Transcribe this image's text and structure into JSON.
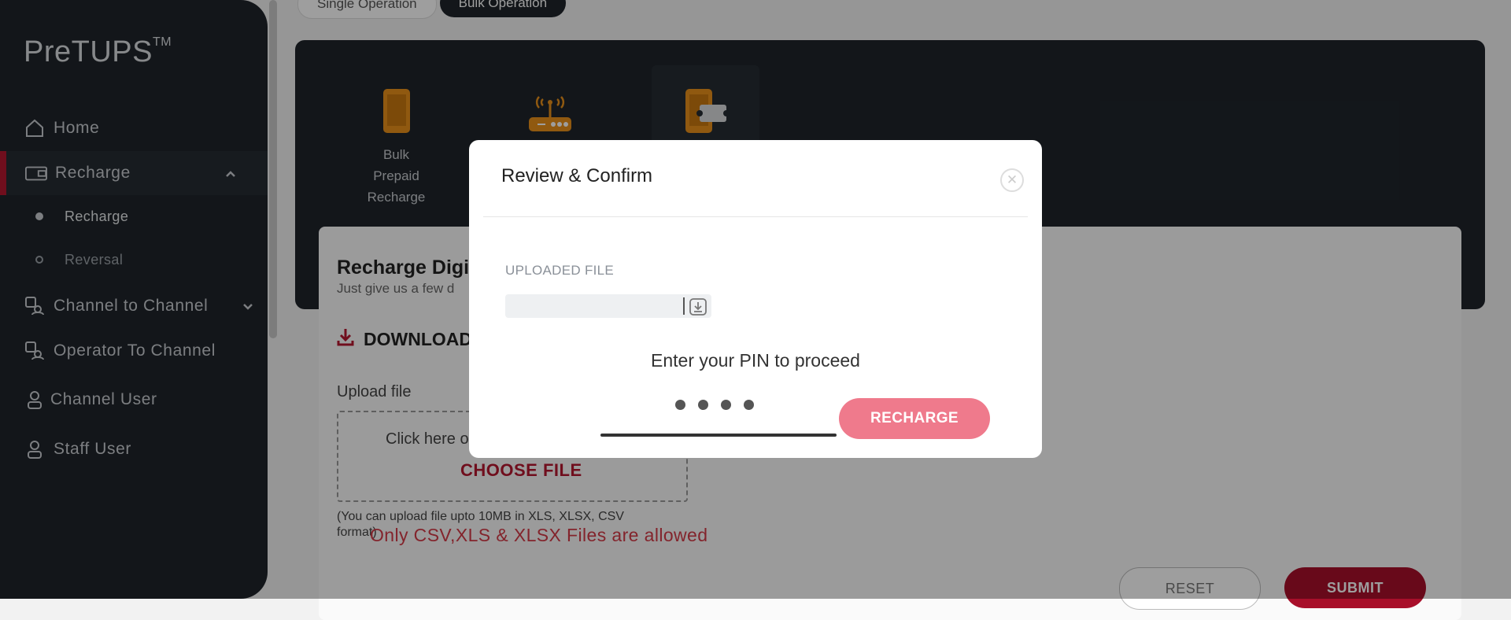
{
  "app": {
    "logo": "PreTUPS",
    "logo_tm": "TM"
  },
  "sidebar": {
    "items": [
      {
        "label": "Home",
        "icon": "home-icon"
      },
      {
        "label": "Recharge",
        "icon": "wallet-icon",
        "active": true,
        "expanded": true
      },
      {
        "label": "Channel to Channel",
        "icon": "transfer-icon"
      },
      {
        "label": "Operator To Channel",
        "icon": "transfer-icon"
      },
      {
        "label": "Channel User",
        "icon": "user-icon"
      },
      {
        "label": "Staff User",
        "icon": "user-icon"
      }
    ],
    "sub_items": [
      {
        "label": "Recharge",
        "active": true
      },
      {
        "label": "Reversal",
        "active": false
      }
    ]
  },
  "toggles": {
    "single": "Single Operation",
    "bulk": "Bulk Operation"
  },
  "tiles": [
    {
      "lines": [
        "Bulk",
        "Prepaid",
        "Recharge"
      ],
      "icon": "phone-icon"
    },
    {
      "lines": [],
      "icon": "router-icon"
    },
    {
      "lines": [],
      "icon": "digital-voucher-icon",
      "selected": true
    }
  ],
  "card": {
    "title": "Recharge Digi",
    "subtitle": "Just give us a few d",
    "download": "DOWNLOAD",
    "upload_label": "Upload file",
    "drop_text": "Click here o",
    "choose": "CHOOSE FILE",
    "hint": "(You can upload file upto 10MB in XLS, XLSX, CSV format)",
    "error": "Only CSV,XLS & XLSX Files are allowed",
    "reset": "RESET",
    "submit": "SUBMIT"
  },
  "modal": {
    "title": "Review & Confirm",
    "uploaded_file_label": "UPLOADED FILE",
    "pin_label": "Enter your PIN to proceed",
    "recharge_button": "RECHARGE"
  },
  "colors": {
    "brand": "#a80f2a",
    "sidebar": "#1f252b",
    "accent_orange": "#e8901a",
    "recharge_button": "#ef7a8c"
  }
}
